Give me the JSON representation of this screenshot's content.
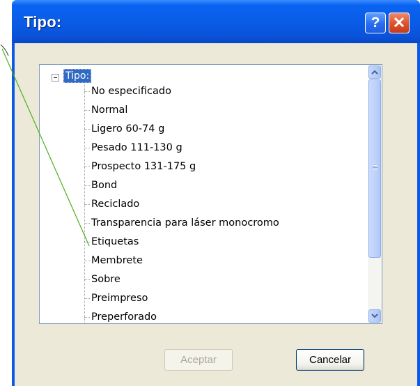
{
  "window": {
    "title": "Tipo:",
    "help_label": "?",
    "close_label": "✕"
  },
  "tree": {
    "root_label": "Tipo:",
    "items": [
      "No especificado",
      "Normal",
      "Ligero 60-74 g",
      "Pesado 111-130 g",
      "Prospecto 131-175 g",
      "Bond",
      "Reciclado",
      "Transparencia para láser monocromo",
      "Etiquetas",
      "Membrete",
      "Sobre",
      "Preimpreso",
      "Preperforado"
    ]
  },
  "scrollbar": {
    "up_icon": "scroll-up-arrow-icon",
    "down_icon": "scroll-down-arrow-icon"
  },
  "buttons": {
    "ok_label": "Aceptar",
    "ok_enabled": false,
    "cancel_label": "Cancelar"
  },
  "colors": {
    "titlebar": "#0a5be6",
    "selection": "#316ac5",
    "callout_line": "#4caf1c",
    "dialog_face": "#ece9d8"
  }
}
